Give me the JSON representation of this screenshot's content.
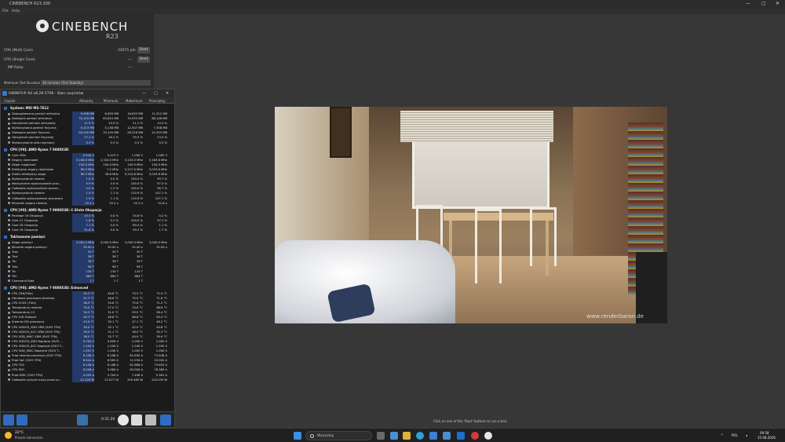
{
  "cinebench": {
    "window_title": "CINEBENCH R23.200",
    "menu": [
      "File",
      "Help"
    ],
    "logo_text": "CINEBENCH",
    "logo_version": "R23",
    "rows": [
      {
        "label": "CPU (Multi Core)",
        "value": "22971 pts",
        "button": "Start"
      },
      {
        "label": "CPU (Single Core)",
        "value": "---",
        "button": "Start"
      },
      {
        "label": "MP Ratio",
        "value": "---",
        "button": ""
      }
    ],
    "min_duration_label": "Minimum Test Duration",
    "min_duration_value": "30 minutes (Test Stability)",
    "status": "Click on one of the 'Start' buttons to run a test.",
    "watermark": "www.renderbaron.de"
  },
  "hwinfo": {
    "title": "HWiNFO® 64 v8.26-5700 - Stan czujników",
    "columns": [
      "Czujnik",
      "Aktualny",
      "Minimum",
      "Maksimum",
      "Przeciętny"
    ],
    "timer": "0:31:26",
    "groups": [
      {
        "name": "System: MSI MS-7E12",
        "rows": [
          [
            "Zaangażowana pamięć wirtualna",
            "9,498 MB",
            "8,699 MB",
            "16,833 MB",
            "11,512 MB"
          ],
          [
            "Dostępna pamięć wirtualna",
            "70,103 MB",
            "63,810 MB",
            "70,935 MB",
            "68,146 MB"
          ],
          [
            "Obciążenie pamięci wirtualnej",
            "11.9 %",
            "10.9 %",
            "21.1 %",
            "14.4 %"
          ],
          [
            "Wykorzystana pamięć fizyczna",
            "5,413 MB",
            "5,138 MB",
            "12,507 MB",
            "7,308 MB"
          ],
          [
            "Dostępna pamięć fizyczna",
            "26,240 MB",
            "19,145 MB",
            "26,518 MB",
            "24,353 MB"
          ],
          [
            "Obciążenie pamięci fizycznej",
            "17.1 %",
            "16.2 %",
            "39.5 %",
            "23.0 %"
          ],
          [
            "Wykorzystanie pliku wymiany",
            "0.3 %",
            "0.3 %",
            "0.3 %",
            "0.3 %"
          ]
        ]
      },
      {
        "name": "CPU [#0]: AMD Ryzen 7 9800X3D",
        "rows": [
          [
            "Core VIDs",
            "0.944 V",
            "0.415 V",
            "1.090 V",
            "1.082 V"
          ],
          [
            "Zegary rdzeniowe",
            "5,246.0 MHz",
            "2,344.0 MHz",
            "5,225.0 MHz",
            "5,183.6 MHz"
          ],
          [
            "Zegar magistrali",
            "100.0 MHz",
            "100.0 MHz",
            "100.0 MHz",
            "100.0 MHz"
          ],
          [
            "Efektywne zegary rdzeniowe",
            "69.3 MHz",
            "7.2 MHz",
            "5,217.0 MHz",
            "5,033.6 MHz"
          ],
          [
            "Średni efektywny zegar",
            "69.3 MHz",
            "36.6 MHz",
            "5,210.8 MHz",
            "5,033.6 MHz"
          ],
          [
            "Wykorzystanie rdzenia",
            "1.0 %",
            "0.0 %",
            "100.0 %",
            "95.7 %"
          ],
          [
            "Maksymalne wykorzystanie proc...",
            "5.9 %",
            "4.0 %",
            "100.0 %",
            "97.5 %"
          ],
          [
            "Całkowite wykorzystanie proces...",
            "2.0 %",
            "1.2 %",
            "100.0 %",
            "96.7 %"
          ],
          [
            "Wykorzystanie rdzenia",
            "1.5 %",
            "1.1 %",
            "110.9 %",
            "107.1 %"
          ],
          [
            "Całkowite wykorzystanie procesora",
            "1.5 %",
            "1.1 %",
            "110.9 %",
            "107.1 %"
          ],
          [
            "Mnożniki zegara rdzenia",
            "22.4 x",
            "22.4 x",
            "52.3 x",
            "51.8 x"
          ]
        ]
      },
      {
        "name": "CPU [#0]: AMD Ryzen 7 9800X3D: C-State Okupacja",
        "rows": [
          [
            "Package C6 Okupacja",
            "15.4 %",
            "0.0 %",
            "54.8 %",
            "0.2 %"
          ],
          [
            "Core C1 Okupacja",
            "1.6 %",
            "0.2 %",
            "100.0 %",
            "97.2 %"
          ],
          [
            "Core C6 Okupacja",
            "7.1 %",
            "0.0 %",
            "89.4 %",
            "1.1 %"
          ],
          [
            "Core C6 Okupacja",
            "91.6 %",
            "0.0 %",
            "99.2 %",
            "1.7 %"
          ]
        ]
      },
      {
        "name": "Taktowanie pamięci",
        "rows": [
          [
            "Zegar pamięci",
            "3,000.0 MHz",
            "3,000.0 MHz",
            "3,000.0 MHz",
            "3,000.0 MHz"
          ],
          [
            "Mnożnik zegara pamięci",
            "30.00 x",
            "30.00 x",
            "30.00 x",
            "30.00 x"
          ],
          [
            "Tcas",
            "30 T",
            "30 T",
            "30 T",
            ""
          ],
          [
            "Trcd",
            "38 T",
            "38 T",
            "38 T",
            ""
          ],
          [
            "Trp",
            "38 T",
            "38 T",
            "38 T",
            ""
          ],
          [
            "Tras",
            "96 T",
            "96 T",
            "96 T",
            ""
          ],
          [
            "Trc",
            "134 T",
            "134 T",
            "134 T",
            ""
          ],
          [
            "Trfc",
            "884 T",
            "884 T",
            "884 T",
            ""
          ],
          [
            "Command Rate",
            "1 T",
            "1 T",
            "1 T",
            ""
          ]
        ]
      },
      {
        "name": "CPU [#0]: AMD Ryzen 7 9800X3D: Enhanced",
        "rows": [
          [
            "CPU (Tctl/Tdie)",
            "55.3 °C",
            "46.8 °C",
            "74.5 °C",
            "72.4 °C"
          ],
          [
            "Obudowa procesora (średnia)",
            "51.3 °C",
            "48.6 °C",
            "75.0 °C",
            "71.6 °C"
          ],
          [
            "CPU CCD1 (Tdie)",
            "38.9 °C",
            "34.6 °C",
            "75.6 °C",
            "71.2 °C"
          ],
          [
            "Temperatury rdzenia",
            "33.0 °C",
            "27.0 °C",
            "74.6 °C",
            "68.6 °C"
          ],
          [
            "Temperatury L3",
            "34.3 °C",
            "31.0 °C",
            "53.5 °C",
            "58.4 °C"
          ],
          [
            "CPU IOD Hotspot",
            "50.3 °C",
            "46.8 °C",
            "66.8 °C",
            "63.4 °C"
          ],
          [
            "Średnia IOD procesora",
            "43.6 °C",
            "39.1 °C",
            "47.1 °C",
            "46.2 °C"
          ],
          [
            "CPU VDDCR_VDD VRM (SVI3 TFN)",
            "39.0 °C",
            "32.1 °C",
            "42.0 °C",
            "40.8 °C"
          ],
          [
            "CPU VDDCR_SOC VRM (SVI3 TFN)",
            "39.0 °C",
            "31.1 °C",
            "36.0 °C",
            "35.3 °C"
          ],
          [
            "CPU VDD_MISC VRM (SVI3 TFN)",
            "36.0 °C",
            "33.7 °C",
            "40.0 °C",
            "39.9 °C"
          ],
          [
            "CPU VDDCR_VDD Napięcie (SVI3 ...",
            "0.764 V",
            "0.695 V",
            "1.090 V",
            "1.081 V"
          ],
          [
            "CPU VDDCR_SOC Napięcie (SVI3 T...",
            "1.200 V",
            "1.200 V",
            "1.200 V",
            "1.200 V"
          ],
          [
            "CPU VDD_MISC Napięcie (SVI3 T...",
            "1.091 V",
            "1.090 V",
            "1.092 V",
            "1.090 V"
          ],
          [
            "Prąd rdzenia procesora (SVI3 TFN)",
            "6.108 A",
            "8.188 A",
            "81.890 A",
            "73.648 A"
          ],
          [
            "Prąd SoC (SVI3 TFN)",
            "8.942 A",
            "8.562 A",
            "12.294 A",
            "10.002 A"
          ],
          [
            "CPU TDC",
            "6.108 A",
            "6.188 A",
            "81.888 A",
            "73.653 A"
          ],
          [
            "CPU EDC",
            "6.508 A",
            "5.980 A",
            "83.000 A",
            "76.389 A"
          ],
          [
            "Prąd MISC (SVI3 TFN)",
            "4.059 A",
            "3.764 A",
            "7.408 A",
            "5.381 A"
          ],
          [
            "Całkowite zużycie mocy przez pr...",
            "22.426 W",
            "21.677 W",
            "109.480 W",
            "104.295 W"
          ]
        ]
      }
    ]
  },
  "taskbar": {
    "weather_temp": "22°C",
    "weather_desc": "Prawie słonecznie",
    "search_placeholder": "Wyszukaj",
    "lang": "POL",
    "time": "09:58",
    "date": "15.08.2026"
  }
}
